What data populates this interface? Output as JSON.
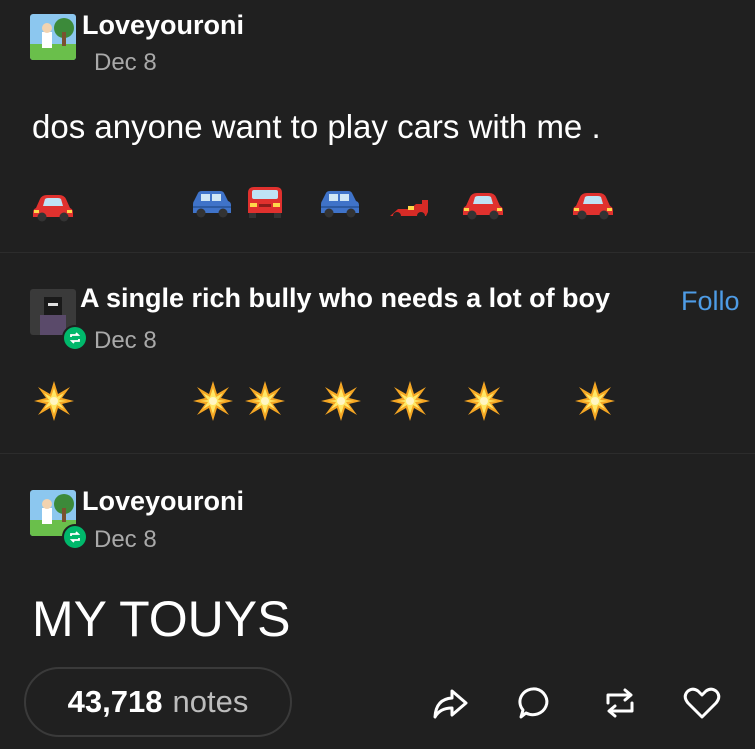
{
  "posts": [
    {
      "username": "Loveyouroni",
      "date": "Dec 8",
      "text": "dos anyone want to play cars with me .",
      "emoji_row": [
        "red-car",
        "blue-suv",
        "red-car-front",
        "blue-suv",
        "race-car",
        "red-car",
        "red-car"
      ]
    },
    {
      "username": "A single rich bully who needs a lot of boy",
      "follow_label": "Follo",
      "date": "Dec 8",
      "emoji_row": [
        "collision",
        "collision",
        "collision",
        "collision",
        "collision",
        "collision",
        "collision"
      ]
    },
    {
      "username": "Loveyouroni",
      "date": "Dec 8",
      "text": "MY TOUYS"
    }
  ],
  "footer": {
    "notes_count": "43,718",
    "notes_label": "notes",
    "actions": [
      "share-icon",
      "reply-icon",
      "reblog-icon",
      "like-icon"
    ]
  },
  "colors": {
    "background": "#202020",
    "accent_follow": "#4e9ce6",
    "reblog_badge": "#00b86b",
    "muted": "#a9a9a9"
  }
}
